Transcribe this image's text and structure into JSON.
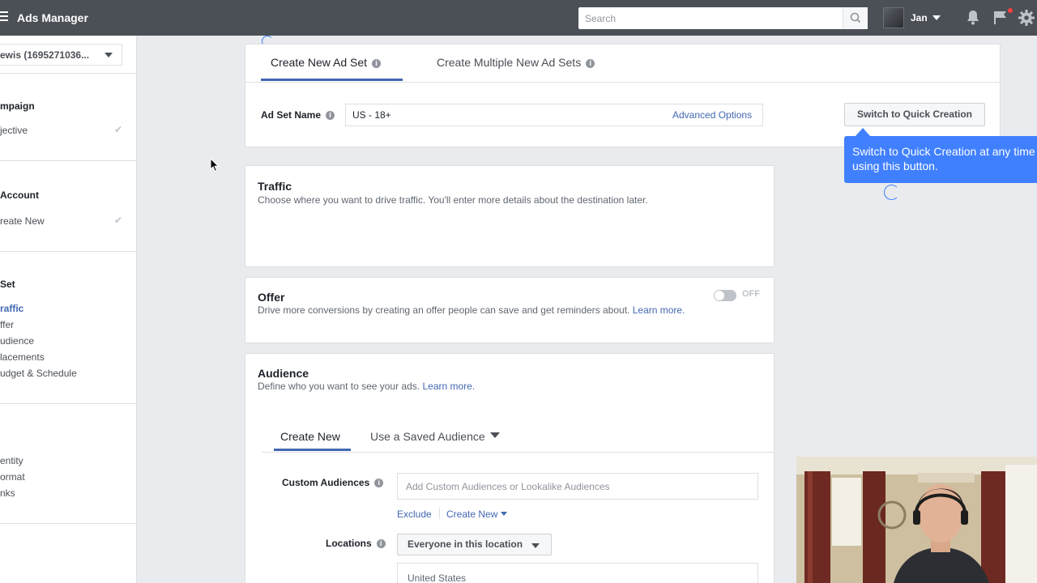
{
  "topbar": {
    "app_title": "Ads Manager",
    "search_placeholder": "Search",
    "user_name": "Jan"
  },
  "sidebar": {
    "account_selector": "ewis (1695271036...",
    "sections": {
      "campaign": {
        "heading": "mpaign",
        "items": [
          "jective"
        ]
      },
      "account": {
        "heading": "Account",
        "items": [
          "reate New"
        ]
      },
      "adset": {
        "heading": "Set",
        "items": [
          "raffic",
          "ffer",
          "udience",
          "lacements",
          "udget & Schedule"
        ]
      },
      "ad": {
        "items": [
          "entity",
          "ormat",
          "nks"
        ]
      }
    }
  },
  "adset_card": {
    "tabs": [
      "Create New Ad Set",
      "Create Multiple New Ad Sets"
    ],
    "name_label": "Ad Set Name",
    "name_value": "US - 18+",
    "advanced_options": "Advanced Options",
    "quick_creation_button": "Switch to Quick Creation"
  },
  "tooltip": {
    "text": "Switch to Quick Creation at any time using this button."
  },
  "traffic": {
    "title": "Traffic",
    "description": "Choose where you want to drive traffic. You'll enter more details about the destination later."
  },
  "offer": {
    "title": "Offer",
    "description": "Drive more conversions by creating an offer people can save and get reminders about.",
    "learn_more": "Learn more.",
    "toggle_state": "OFF"
  },
  "audience": {
    "title": "Audience",
    "description": "Define who you want to see your ads.",
    "learn_more": "Learn more.",
    "tabs": [
      "Create New",
      "Use a Saved Audience"
    ],
    "custom_audiences_label": "Custom Audiences",
    "custom_audiences_placeholder": "Add Custom Audiences or Lookalike Audiences",
    "exclude": "Exclude",
    "create_new": "Create New",
    "locations_label": "Locations",
    "locations_select": "Everyone in this location",
    "location_value": "United States"
  },
  "colors": {
    "accent": "#4267b2",
    "tooltip": "#4080ff",
    "topbar": "#4b4f56"
  }
}
